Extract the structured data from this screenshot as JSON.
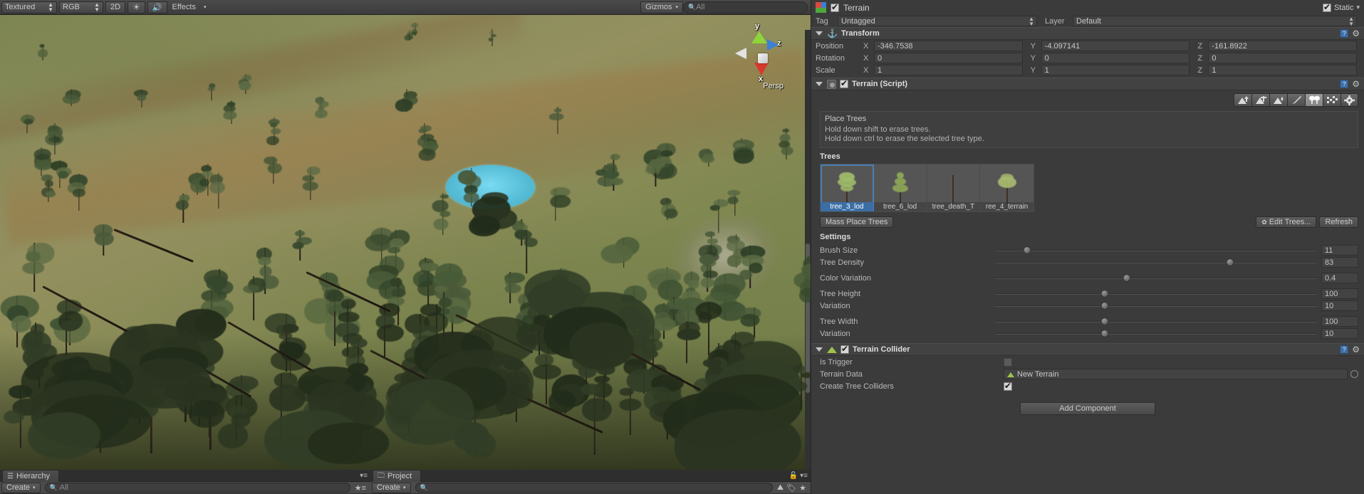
{
  "scene_toolbar": {
    "draw_mode": "Textured",
    "render_mode": "RGB",
    "two_d": "2D",
    "light_icon": "sun-icon",
    "audio_icon": "audio-icon",
    "effects": "Effects",
    "gizmos": "Gizmos",
    "search_placeholder": "All",
    "search_icon": "search-icon"
  },
  "scene_gizmo": {
    "axis_y": "y",
    "axis_z": "z",
    "axis_x": "x",
    "projection": "Persp"
  },
  "hierarchy": {
    "tab": "Hierarchy",
    "tab_icon": "hierarchy-icon",
    "create": "Create",
    "search_placeholder": "All",
    "lock_icon": "favorite-icon",
    "menu_icon": "panel-menu-icon"
  },
  "project": {
    "tab": "Project",
    "tab_icon": "folder-icon",
    "create": "Create",
    "search_placeholder": "",
    "icons": [
      "terrain-filter-icon",
      "label-filter-icon",
      "favorite-icon"
    ],
    "lock_icon": "lock-icon",
    "menu_icon": "panel-menu-icon"
  },
  "inspector": {
    "object_icon": "gameobject-icon",
    "enabled": true,
    "name": "Terrain",
    "static_label": "Static",
    "static_checked": true,
    "tag_label": "Tag",
    "tag_value": "Untagged",
    "layer_label": "Layer",
    "layer_value": "Default",
    "transform": {
      "title": "Transform",
      "icon": "transform-icon",
      "rows": [
        {
          "label": "Position",
          "x": "-346.7538",
          "y": "-4.097141",
          "z": "-161.8922"
        },
        {
          "label": "Rotation",
          "x": "0",
          "y": "0",
          "z": "0"
        },
        {
          "label": "Scale",
          "x": "1",
          "y": "1",
          "z": "1"
        }
      ],
      "axis_labels": [
        "X",
        "Y",
        "Z"
      ]
    },
    "terrain_script": {
      "title": "Terrain (Script)",
      "icon": "script-icon",
      "enabled": true,
      "tools": [
        {
          "name": "raise-lower-terrain-tool",
          "selected": false
        },
        {
          "name": "paint-height-tool",
          "selected": false
        },
        {
          "name": "smooth-height-tool",
          "selected": false
        },
        {
          "name": "paint-texture-tool",
          "selected": false
        },
        {
          "name": "place-trees-tool",
          "selected": true
        },
        {
          "name": "paint-details-tool",
          "selected": false
        },
        {
          "name": "terrain-settings-tool",
          "selected": false
        }
      ],
      "info_title": "Place Trees",
      "info_line1": "Hold down shift to erase trees.",
      "info_line2": "Hold down ctrl to erase the selected tree type.",
      "trees_label": "Trees",
      "trees": [
        {
          "name": "tree_3_lod",
          "selected": true,
          "canopy": "#9fbb6a",
          "shape": "bushy"
        },
        {
          "name": "tree_6_lod",
          "selected": false,
          "canopy": "#8fa857",
          "shape": "conifer"
        },
        {
          "name": "tree_death_T",
          "selected": false,
          "canopy": "#5d5040",
          "shape": "bare"
        },
        {
          "name": "ree_4_terrain",
          "selected": false,
          "canopy": "#a8b96d",
          "shape": "round"
        }
      ],
      "mass_place_label": "Mass Place Trees",
      "edit_trees_label": "Edit Trees...",
      "edit_trees_icon": "gear-icon",
      "refresh_label": "Refresh",
      "settings_label": "Settings",
      "settings": [
        {
          "label": "Brush Size",
          "value": "11",
          "knob_pct": 10,
          "group": 0
        },
        {
          "label": "Tree Density",
          "value": "83",
          "knob_pct": 73,
          "group": 0
        },
        {
          "label": "Color Variation",
          "value": "0.4",
          "knob_pct": 41,
          "group": 1
        },
        {
          "label": "Tree Height",
          "value": "100",
          "knob_pct": 34,
          "group": 2
        },
        {
          "label": "Variation",
          "value": "10",
          "knob_pct": 34,
          "group": 2
        },
        {
          "label": "Tree Width",
          "value": "100",
          "knob_pct": 34,
          "group": 3
        },
        {
          "label": "Variation",
          "value": "10",
          "knob_pct": 34,
          "group": 3
        }
      ]
    },
    "terrain_collider": {
      "title": "Terrain Collider",
      "icon": "terrain-collider-icon",
      "enabled": true,
      "is_trigger_label": "Is Trigger",
      "is_trigger_checked": false,
      "terrain_data_label": "Terrain Data",
      "terrain_data_value": "New Terrain",
      "create_tree_colliders_label": "Create Tree Colliders",
      "create_tree_colliders_checked": true
    },
    "add_component_label": "Add Component",
    "help_icon": "help-icon",
    "gear_icon": "gear-icon"
  },
  "colors": {
    "panel_bg": "#3b3b3b",
    "accent_selection": "#3b6ea5",
    "brush_cyan": "#5ec8ef",
    "terrain_green": "#8a8c58"
  }
}
